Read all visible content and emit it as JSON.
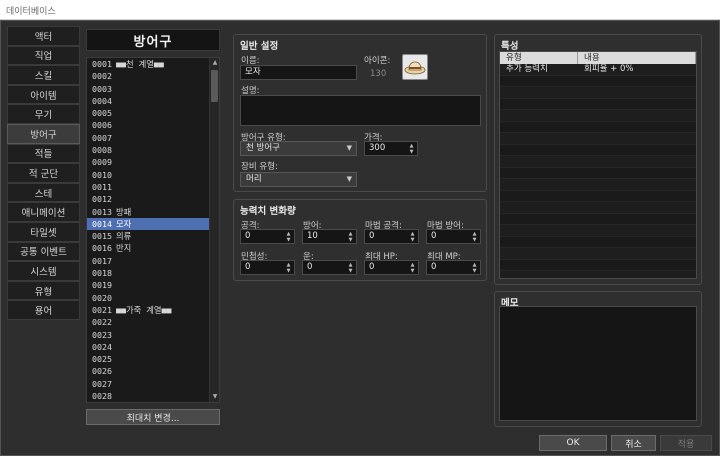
{
  "window": {
    "title": "데이터베이스"
  },
  "categories": [
    {
      "label": "액터",
      "active": false
    },
    {
      "label": "직업",
      "active": false
    },
    {
      "label": "스킬",
      "active": false
    },
    {
      "label": "아이템",
      "active": false
    },
    {
      "label": "무기",
      "active": false
    },
    {
      "label": "방어구",
      "active": true
    },
    {
      "label": "적들",
      "active": false
    },
    {
      "label": "적 군단",
      "active": false
    },
    {
      "label": "스테",
      "active": false
    },
    {
      "label": "애니메이션",
      "active": false
    },
    {
      "label": "타일셋",
      "active": false
    },
    {
      "label": "공통 이벤트",
      "active": false
    },
    {
      "label": "시스템",
      "active": false
    },
    {
      "label": "유형",
      "active": false
    },
    {
      "label": "용어",
      "active": false
    }
  ],
  "list": {
    "title": "방어구",
    "selected_index": 13,
    "items": [
      {
        "id": "0001",
        "name": "■■천 계열■■"
      },
      {
        "id": "0002",
        "name": ""
      },
      {
        "id": "0003",
        "name": ""
      },
      {
        "id": "0004",
        "name": ""
      },
      {
        "id": "0005",
        "name": ""
      },
      {
        "id": "0006",
        "name": ""
      },
      {
        "id": "0007",
        "name": ""
      },
      {
        "id": "0008",
        "name": ""
      },
      {
        "id": "0009",
        "name": ""
      },
      {
        "id": "0010",
        "name": ""
      },
      {
        "id": "0011",
        "name": ""
      },
      {
        "id": "0012",
        "name": ""
      },
      {
        "id": "0013",
        "name": "방패"
      },
      {
        "id": "0014",
        "name": "모자"
      },
      {
        "id": "0015",
        "name": "의류"
      },
      {
        "id": "0016",
        "name": "반지"
      },
      {
        "id": "0017",
        "name": ""
      },
      {
        "id": "0018",
        "name": ""
      },
      {
        "id": "0019",
        "name": ""
      },
      {
        "id": "0020",
        "name": ""
      },
      {
        "id": "0021",
        "name": "■■가죽 계열■■"
      },
      {
        "id": "0022",
        "name": ""
      },
      {
        "id": "0023",
        "name": ""
      },
      {
        "id": "0024",
        "name": ""
      },
      {
        "id": "0025",
        "name": ""
      },
      {
        "id": "0026",
        "name": ""
      },
      {
        "id": "0027",
        "name": ""
      },
      {
        "id": "0028",
        "name": ""
      }
    ],
    "max_button": "최대치 변경..."
  },
  "general": {
    "title": "일반 설정",
    "name_label": "이름:",
    "name_value": "모자",
    "icon_label": "아이콘:",
    "icon_index": "130",
    "desc_label": "설명:",
    "armor_type_label": "방어구 유형:",
    "armor_type_value": "천 방어구",
    "price_label": "가격:",
    "price_value": "300",
    "equip_type_label": "장비 유형:",
    "equip_type_value": "머리"
  },
  "params": {
    "title": "능력치 변화량",
    "fields": [
      {
        "label": "공격:",
        "value": "0"
      },
      {
        "label": "방어:",
        "value": "10"
      },
      {
        "label": "마법 공격:",
        "value": "0"
      },
      {
        "label": "마법 방어:",
        "value": "0"
      },
      {
        "label": "민첩성:",
        "value": "0"
      },
      {
        "label": "운:",
        "value": "0"
      },
      {
        "label": "최대 HP:",
        "value": "0"
      },
      {
        "label": "최대 MP:",
        "value": "0"
      }
    ]
  },
  "traits": {
    "title": "특성",
    "col_type": "유형",
    "col_content": "내용",
    "rows": [
      {
        "type": "추가 능력치",
        "content": "회피율 + 0%"
      }
    ]
  },
  "memo": {
    "title": "메모"
  },
  "buttons": {
    "ok": "OK",
    "cancel": "취소",
    "apply": "적용"
  }
}
